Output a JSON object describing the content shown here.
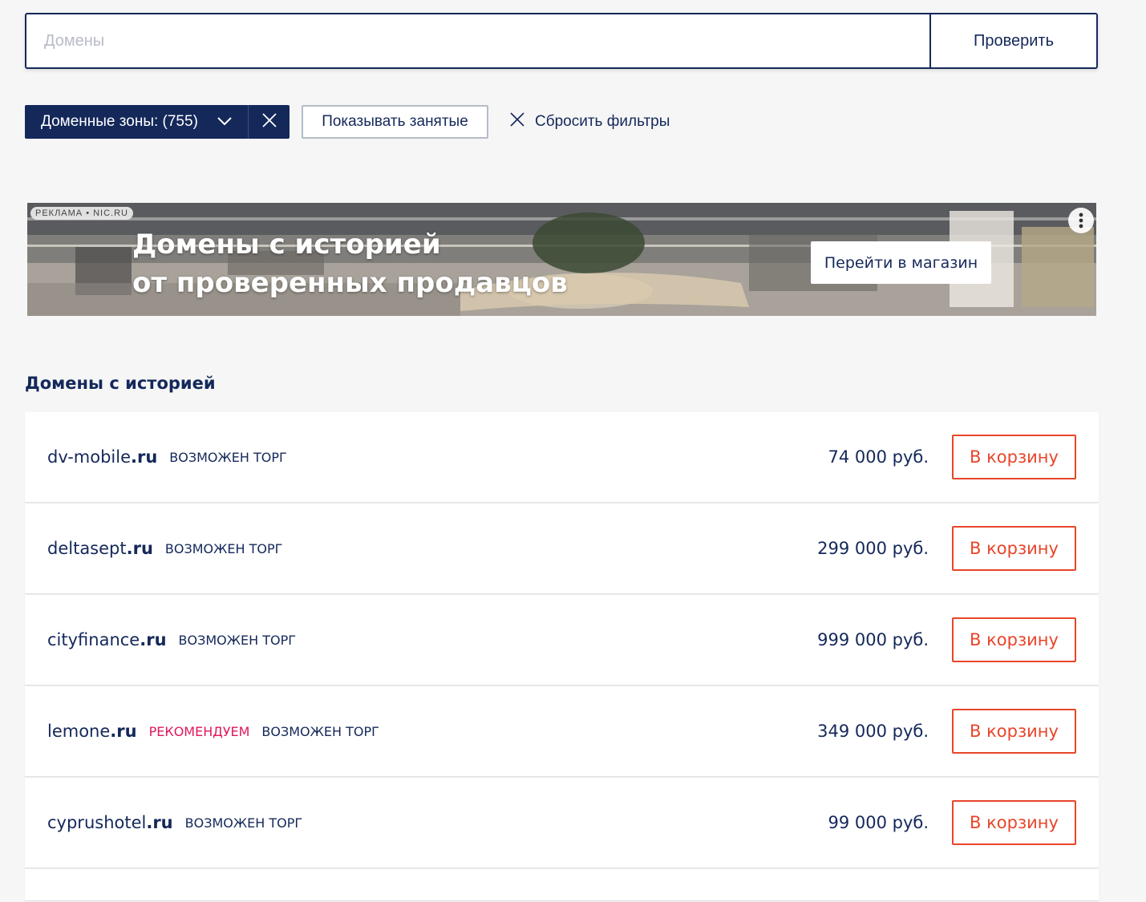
{
  "search": {
    "placeholder": "Домены",
    "button_label": "Проверить"
  },
  "filters": {
    "zones_label": "Доменные зоны: (755)",
    "show_busy_label": "Показывать занятые",
    "reset_label": "Сбросить фильтры"
  },
  "banner": {
    "ad_tag": "РЕКЛАМА • NIC.RU",
    "headline_line1": "Домены с историей",
    "headline_line2": "от проверенных продавцов",
    "button_label": "Перейти в магазин"
  },
  "section": {
    "title": "Домены с историей"
  },
  "domains": [
    {
      "name": "dv-mobile",
      "tld": ".ru",
      "recommend": "",
      "badge": "ВОЗМОЖЕН ТОРГ",
      "price": "74 000 руб.",
      "cart": "В корзину"
    },
    {
      "name": "deltasept",
      "tld": ".ru",
      "recommend": "",
      "badge": "ВОЗМОЖЕН ТОРГ",
      "price": "299 000 руб.",
      "cart": "В корзину"
    },
    {
      "name": "cityfinance",
      "tld": ".ru",
      "recommend": "",
      "badge": "ВОЗМОЖЕН ТОРГ",
      "price": "999 000 руб.",
      "cart": "В корзину"
    },
    {
      "name": "lemone",
      "tld": ".ru",
      "recommend": "РЕКОМЕНДУЕМ",
      "badge": "ВОЗМОЖЕН ТОРГ",
      "price": "349 000 руб.",
      "cart": "В корзину"
    },
    {
      "name": "cyprushotel",
      "tld": ".ru",
      "recommend": "",
      "badge": "ВОЗМОЖЕН ТОРГ",
      "price": "99 000 руб.",
      "cart": "В корзину"
    }
  ],
  "colors": {
    "brand_navy": "#14285a",
    "cart_red": "#e8452a",
    "recommend_pink": "#e0195a",
    "page_bg": "#f6f6f7"
  }
}
